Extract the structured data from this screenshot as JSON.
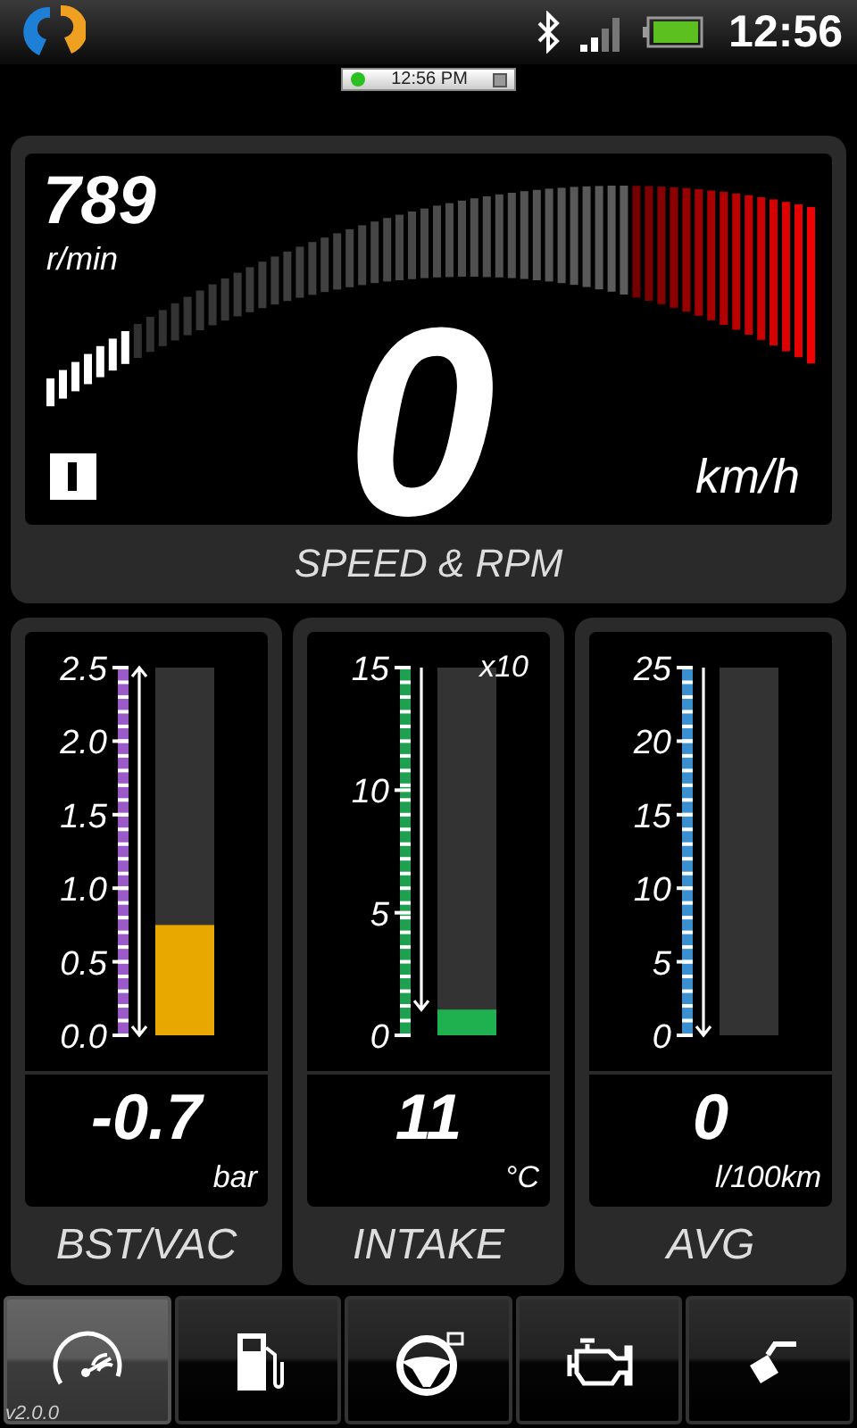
{
  "status_bar": {
    "time": "12:56"
  },
  "notification": {
    "time": "12:56 PM"
  },
  "speed_rpm": {
    "rpm": "789",
    "rpm_unit": "r/min",
    "speed": "0",
    "speed_unit": "km/h",
    "title": "SPEED & RPM"
  },
  "gauges": [
    {
      "kind": "double",
      "ticks": [
        "2.5",
        "2.0",
        "1.5",
        "1.0",
        "0.5",
        "0.0"
      ],
      "color": "#9a5ac8",
      "value": "-0.7",
      "unit": "bar",
      "title": "BST/VAC"
    },
    {
      "kind": "down",
      "ticks": [
        "15",
        "10",
        "5",
        "0"
      ],
      "multiplier": "x10",
      "color": "#1fa050",
      "value": "11",
      "unit": "°C",
      "title": "INTAKE"
    },
    {
      "kind": "down",
      "ticks": [
        "25",
        "20",
        "15",
        "10",
        "5",
        "0"
      ],
      "color": "#3a8fd0",
      "value": "0",
      "unit": "l/100km",
      "title": "AVG"
    }
  ],
  "nav": {
    "version": "v2.0.0",
    "tabs": [
      {
        "kind": "gauge",
        "selected": true
      },
      {
        "kind": "fuel",
        "selected": false
      },
      {
        "kind": "wheel",
        "selected": false
      },
      {
        "kind": "engine",
        "selected": false
      },
      {
        "kind": "nozzle",
        "selected": false
      }
    ]
  }
}
